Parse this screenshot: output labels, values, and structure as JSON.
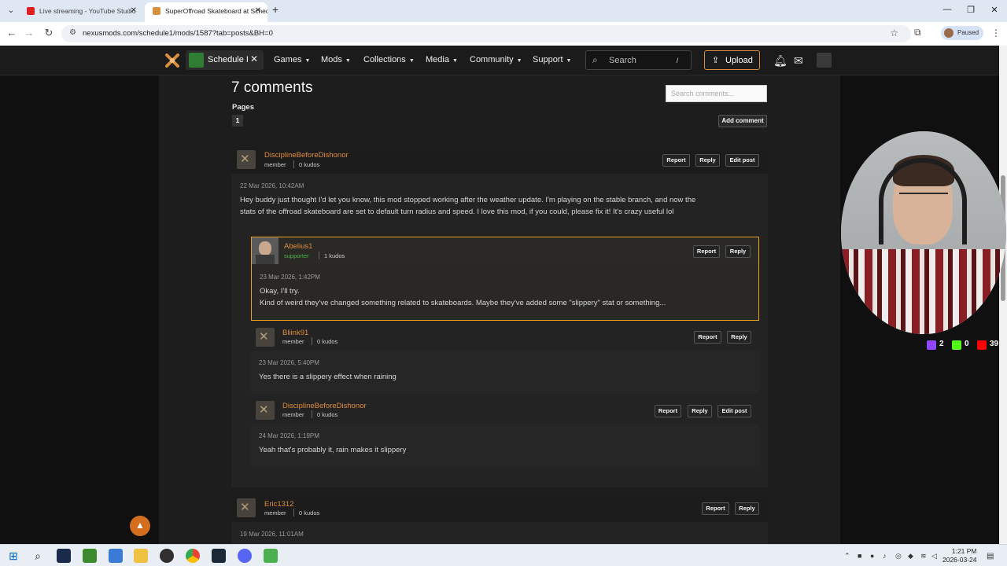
{
  "browser": {
    "tabs": [
      {
        "title": "Live streaming - YouTube Studio",
        "active": false,
        "favicon_color": "#e02020"
      },
      {
        "title": "SuperOffroad Skateboard at Schedule I",
        "active": true,
        "favicon_color": "#d98f40"
      }
    ],
    "url": "nexusmods.com/schedule1/mods/1587?tab=posts&BH=0",
    "profile_status": "Paused"
  },
  "site": {
    "game_name": "Schedule I",
    "menu": [
      "Games",
      "Mods",
      "Collections",
      "Media",
      "Community",
      "Support"
    ],
    "search_placeholder": "Search",
    "search_shortcut": "/",
    "upload_label": "Upload",
    "accent_color": "#d98f40"
  },
  "comments": {
    "title": "7 comments",
    "pages_label": "Pages",
    "current_page": "1",
    "search_placeholder": "Search comments...",
    "add_comment_label": "Add comment",
    "report_label": "Report",
    "reply_label": "Reply",
    "edit_label": "Edit post",
    "thread1": {
      "user": "DisciplineBeforeDishonor",
      "role": "member",
      "kudos": "0 kudos",
      "date": "22 Mar 2026, 10:42AM",
      "text_line1": "Hey buddy just thought I'd let you know, this mod stopped working after the weather update. I'm playing on the stable branch, and now the",
      "text_line2": "stats of the offroad skateboard are set to default turn radius and speed. I love this mod, if you could, please fix it! It's crazy useful lol",
      "replies": [
        {
          "user": "Abelius1",
          "role": "supporter",
          "kudos": "1 kudos",
          "date": "23 Mar 2026, 1:42PM",
          "text_line1": "Okay, I'll try.",
          "text_line2": "Kind of weird they've changed something related to skateboards. Maybe they've added some \"slippery\" stat or something..."
        },
        {
          "user": "Bliink91",
          "role": "member",
          "kudos": "0 kudos",
          "date": "23 Mar 2026, 5:40PM",
          "text_line1": "Yes there is a slippery effect when raining"
        },
        {
          "user": "DisciplineBeforeDishonor",
          "role": "member",
          "kudos": "0 kudos",
          "date": "24 Mar 2026, 1:19PM",
          "text_line1": "Yeah that's probably it, rain makes it slippery"
        }
      ]
    },
    "thread2": {
      "user": "Eric1312",
      "role": "member",
      "kudos": "0 kudos",
      "date": "19 Mar 2026, 11:01AM"
    }
  },
  "stream_stats": {
    "twitch": "2",
    "kick": "0",
    "youtube": "39"
  },
  "taskbar": {
    "time": "1:21 PM",
    "date": "2026-03-24"
  }
}
